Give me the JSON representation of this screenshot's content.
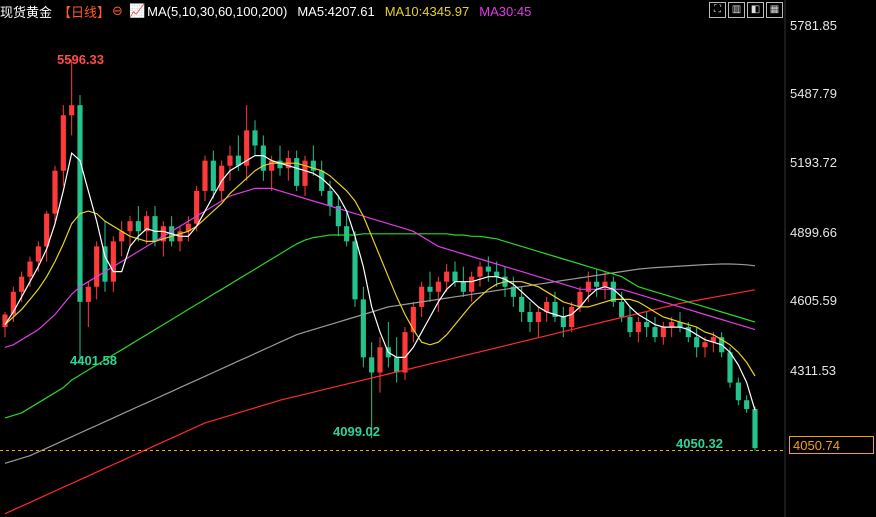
{
  "header": {
    "symbol": "现货黄金",
    "period": "【日线】",
    "ma_label": "MA(5,10,30,60,100,200)",
    "ma5": "MA5:4207.61",
    "ma10": "MA10:4345.97",
    "ma30": "MA30:45"
  },
  "toolbar": [
    "⛶",
    "▥",
    "◧",
    "▦"
  ],
  "colors": {
    "up": "#ff3a3a",
    "down": "#22c38e",
    "ma5": "#ffffff",
    "ma10": "#e8d21c",
    "ma30": "#e23ae6",
    "ma60": "#2bd62b",
    "ma100": "#9a9a9a",
    "ma200": "#ff2b2b",
    "last_line": "#f4a300"
  },
  "chart_data": {
    "type": "candlestick",
    "y_ticks": [
      "5781.85",
      "5487.79",
      "5193.72",
      "4899.66",
      "4605.59",
      "4311.53"
    ],
    "ylim": [
      3787,
      5837
    ],
    "last_price": "4050.74",
    "annotations": {
      "high": "5596.33",
      "low1": "4401.58",
      "low2": "4099.02",
      "low3": "4050.32"
    },
    "candles": [
      [
        4540,
        4600,
        4500,
        4590
      ],
      [
        4590,
        4700,
        4560,
        4680
      ],
      [
        4680,
        4760,
        4640,
        4740
      ],
      [
        4740,
        4820,
        4700,
        4800
      ],
      [
        4800,
        4880,
        4760,
        4860
      ],
      [
        4860,
        5000,
        4800,
        4990
      ],
      [
        4990,
        5180,
        4950,
        5160
      ],
      [
        5160,
        5420,
        5100,
        5380
      ],
      [
        5380,
        5600,
        5300,
        5420
      ],
      [
        5420,
        5460,
        4401,
        4640
      ],
      [
        4640,
        4720,
        4540,
        4700
      ],
      [
        4700,
        4880,
        4650,
        4860
      ],
      [
        4860,
        4960,
        4680,
        4720
      ],
      [
        4720,
        4900,
        4680,
        4880
      ],
      [
        4880,
        4960,
        4820,
        4920
      ],
      [
        4920,
        4980,
        4860,
        4960
      ],
      [
        4960,
        5020,
        4880,
        4920
      ],
      [
        4920,
        5000,
        4870,
        4980
      ],
      [
        4980,
        5020,
        4860,
        4880
      ],
      [
        4880,
        4960,
        4820,
        4940
      ],
      [
        4940,
        4980,
        4860,
        4880
      ],
      [
        4880,
        4940,
        4840,
        4920
      ],
      [
        4920,
        4980,
        4880,
        4950
      ],
      [
        4950,
        5100,
        4920,
        5080
      ],
      [
        5080,
        5220,
        5040,
        5200
      ],
      [
        5200,
        5240,
        5050,
        5080
      ],
      [
        5080,
        5200,
        5040,
        5180
      ],
      [
        5180,
        5260,
        5120,
        5220
      ],
      [
        5220,
        5300,
        5160,
        5180
      ],
      [
        5180,
        5420,
        5120,
        5320
      ],
      [
        5320,
        5360,
        5220,
        5260
      ],
      [
        5260,
        5300,
        5120,
        5160
      ],
      [
        5160,
        5220,
        5080,
        5200
      ],
      [
        5200,
        5260,
        5140,
        5170
      ],
      [
        5170,
        5240,
        5120,
        5210
      ],
      [
        5210,
        5240,
        5080,
        5100
      ],
      [
        5100,
        5220,
        5060,
        5200
      ],
      [
        5200,
        5260,
        5140,
        5160
      ],
      [
        5160,
        5200,
        5060,
        5080
      ],
      [
        5080,
        5120,
        4980,
        5020
      ],
      [
        5020,
        5060,
        4900,
        4940
      ],
      [
        4940,
        5000,
        4860,
        4880
      ],
      [
        4880,
        4920,
        4620,
        4650
      ],
      [
        4650,
        4700,
        4380,
        4420
      ],
      [
        4420,
        4480,
        4099,
        4360
      ],
      [
        4360,
        4500,
        4280,
        4460
      ],
      [
        4460,
        4560,
        4380,
        4420
      ],
      [
        4420,
        4500,
        4320,
        4360
      ],
      [
        4360,
        4540,
        4330,
        4520
      ],
      [
        4520,
        4640,
        4480,
        4620
      ],
      [
        4620,
        4720,
        4580,
        4700
      ],
      [
        4700,
        4760,
        4640,
        4680
      ],
      [
        4680,
        4740,
        4600,
        4720
      ],
      [
        4720,
        4790,
        4680,
        4760
      ],
      [
        4760,
        4800,
        4700,
        4720
      ],
      [
        4720,
        4780,
        4660,
        4680
      ],
      [
        4680,
        4760,
        4640,
        4740
      ],
      [
        4740,
        4800,
        4700,
        4780
      ],
      [
        4780,
        4820,
        4720,
        4760
      ],
      [
        4760,
        4800,
        4700,
        4740
      ],
      [
        4740,
        4780,
        4660,
        4700
      ],
      [
        4700,
        4740,
        4620,
        4660
      ],
      [
        4660,
        4700,
        4560,
        4600
      ],
      [
        4600,
        4640,
        4520,
        4560
      ],
      [
        4560,
        4620,
        4500,
        4600
      ],
      [
        4600,
        4660,
        4560,
        4640
      ],
      [
        4640,
        4680,
        4560,
        4580
      ],
      [
        4580,
        4620,
        4500,
        4540
      ],
      [
        4540,
        4640,
        4520,
        4620
      ],
      [
        4620,
        4700,
        4600,
        4680
      ],
      [
        4680,
        4760,
        4640,
        4720
      ],
      [
        4720,
        4770,
        4660,
        4700
      ],
      [
        4700,
        4760,
        4650,
        4720
      ],
      [
        4720,
        4740,
        4620,
        4640
      ],
      [
        4640,
        4680,
        4560,
        4580
      ],
      [
        4580,
        4620,
        4500,
        4520
      ],
      [
        4520,
        4580,
        4480,
        4560
      ],
      [
        4560,
        4600,
        4500,
        4540
      ],
      [
        4540,
        4580,
        4480,
        4500
      ],
      [
        4500,
        4560,
        4470,
        4540
      ],
      [
        4540,
        4580,
        4500,
        4560
      ],
      [
        4560,
        4600,
        4520,
        4540
      ],
      [
        4540,
        4560,
        4480,
        4500
      ],
      [
        4500,
        4540,
        4420,
        4460
      ],
      [
        4460,
        4500,
        4420,
        4480
      ],
      [
        4480,
        4520,
        4440,
        4500
      ],
      [
        4500,
        4520,
        4420,
        4440
      ],
      [
        4440,
        4460,
        4300,
        4320
      ],
      [
        4320,
        4340,
        4230,
        4250
      ],
      [
        4250,
        4270,
        4200,
        4215
      ],
      [
        4215,
        4225,
        4050,
        4060
      ]
    ],
    "ma5": [
      4550,
      4600,
      4660,
      4720,
      4780,
      4850,
      4950,
      5080,
      5230,
      5200,
      5080,
      4960,
      4820,
      4760,
      4760,
      4860,
      4900,
      4930,
      4920,
      4920,
      4910,
      4900,
      4900,
      4940,
      5000,
      5060,
      5120,
      5160,
      5180,
      5200,
      5220,
      5220,
      5200,
      5190,
      5180,
      5170,
      5160,
      5150,
      5130,
      5100,
      5060,
      5000,
      4900,
      4780,
      4620,
      4520,
      4440,
      4420,
      4420,
      4460,
      4520,
      4580,
      4640,
      4690,
      4720,
      4720,
      4720,
      4730,
      4740,
      4740,
      4730,
      4710,
      4680,
      4650,
      4620,
      4600,
      4590,
      4580,
      4590,
      4620,
      4660,
      4690,
      4700,
      4690,
      4660,
      4620,
      4590,
      4570,
      4550,
      4540,
      4540,
      4540,
      4530,
      4510,
      4490,
      4480,
      4470,
      4440,
      4390,
      4320,
      4210
    ],
    "ma10": [
      4550,
      4580,
      4610,
      4650,
      4690,
      4740,
      4800,
      4870,
      4950,
      4990,
      5000,
      4990,
      4960,
      4940,
      4920,
      4900,
      4890,
      4880,
      4880,
      4890,
      4900,
      4910,
      4920,
      4940,
      4970,
      5000,
      5030,
      5070,
      5100,
      5130,
      5160,
      5180,
      5190,
      5190,
      5190,
      5190,
      5180,
      5170,
      5160,
      5140,
      5110,
      5080,
      5040,
      4980,
      4900,
      4820,
      4740,
      4660,
      4590,
      4530,
      4480,
      4470,
      4480,
      4510,
      4550,
      4590,
      4630,
      4660,
      4690,
      4710,
      4720,
      4720,
      4720,
      4710,
      4700,
      4680,
      4660,
      4640,
      4630,
      4620,
      4620,
      4630,
      4640,
      4650,
      4650,
      4650,
      4640,
      4620,
      4600,
      4580,
      4570,
      4560,
      4550,
      4540,
      4520,
      4510,
      4490,
      4470,
      4440,
      4400,
      4346
    ],
    "ma30": [
      4460,
      4470,
      4490,
      4510,
      4530,
      4560,
      4590,
      4630,
      4670,
      4700,
      4720,
      4740,
      4760,
      4780,
      4800,
      4820,
      4840,
      4860,
      4880,
      4900,
      4920,
      4940,
      4960,
      4980,
      5000,
      5020,
      5040,
      5060,
      5070,
      5080,
      5090,
      5090,
      5090,
      5080,
      5070,
      5060,
      5050,
      5040,
      5030,
      5020,
      5010,
      5000,
      4990,
      4980,
      4970,
      4960,
      4950,
      4940,
      4930,
      4920,
      4900,
      4880,
      4860,
      4850,
      4840,
      4830,
      4820,
      4810,
      4800,
      4790,
      4780,
      4770,
      4760,
      4750,
      4740,
      4730,
      4720,
      4710,
      4700,
      4690,
      4690,
      4690,
      4690,
      4690,
      4690,
      4680,
      4670,
      4660,
      4650,
      4640,
      4630,
      4620,
      4610,
      4600,
      4590,
      4580,
      4570,
      4560,
      4550,
      4540,
      4530
    ],
    "ma60": [
      4180,
      4190,
      4200,
      4220,
      4240,
      4260,
      4280,
      4300,
      4330,
      4350,
      4370,
      4390,
      4410,
      4430,
      4450,
      4470,
      4490,
      4510,
      4530,
      4550,
      4570,
      4590,
      4610,
      4630,
      4650,
      4670,
      4690,
      4710,
      4730,
      4750,
      4770,
      4790,
      4810,
      4830,
      4850,
      4870,
      4885,
      4895,
      4900,
      4905,
      4905,
      4905,
      4905,
      4910,
      4910,
      4910,
      4910,
      4910,
      4910,
      4910,
      4910,
      4910,
      4910,
      4910,
      4905,
      4905,
      4900,
      4900,
      4895,
      4890,
      4880,
      4870,
      4860,
      4850,
      4840,
      4830,
      4820,
      4810,
      4800,
      4790,
      4780,
      4770,
      4760,
      4750,
      4740,
      4720,
      4700,
      4690,
      4680,
      4670,
      4660,
      4650,
      4640,
      4630,
      4620,
      4610,
      4600,
      4590,
      4580,
      4570,
      4560
    ],
    "ma100": [
      4000,
      4010,
      4020,
      4030,
      4045,
      4060,
      4075,
      4090,
      4105,
      4120,
      4135,
      4150,
      4165,
      4180,
      4195,
      4210,
      4225,
      4240,
      4255,
      4270,
      4285,
      4300,
      4315,
      4330,
      4345,
      4360,
      4375,
      4390,
      4405,
      4420,
      4435,
      4450,
      4465,
      4480,
      4495,
      4510,
      4520,
      4530,
      4540,
      4550,
      4560,
      4570,
      4580,
      4590,
      4600,
      4610,
      4620,
      4625,
      4630,
      4635,
      4640,
      4645,
      4650,
      4655,
      4660,
      4665,
      4670,
      4675,
      4680,
      4685,
      4690,
      4695,
      4700,
      4705,
      4710,
      4715,
      4720,
      4725,
      4730,
      4735,
      4740,
      4745,
      4750,
      4755,
      4760,
      4765,
      4770,
      4773,
      4776,
      4778,
      4780,
      4782,
      4784,
      4786,
      4788,
      4789,
      4790,
      4790,
      4789,
      4787,
      4783
    ],
    "ma200": [
      3800,
      3815,
      3830,
      3845,
      3860,
      3875,
      3890,
      3905,
      3920,
      3935,
      3950,
      3965,
      3980,
      3995,
      4010,
      4025,
      4040,
      4055,
      4070,
      4085,
      4100,
      4115,
      4130,
      4145,
      4160,
      4170,
      4180,
      4190,
      4200,
      4210,
      4220,
      4230,
      4240,
      4250,
      4258,
      4266,
      4274,
      4282,
      4290,
      4298,
      4306,
      4314,
      4322,
      4330,
      4338,
      4346,
      4354,
      4362,
      4370,
      4378,
      4386,
      4394,
      4402,
      4410,
      4418,
      4426,
      4434,
      4442,
      4450,
      4458,
      4466,
      4474,
      4482,
      4490,
      4498,
      4506,
      4514,
      4522,
      4530,
      4538,
      4546,
      4554,
      4562,
      4570,
      4578,
      4586,
      4594,
      4602,
      4610,
      4618,
      4626,
      4634,
      4640,
      4646,
      4652,
      4658,
      4664,
      4670,
      4676,
      4682,
      4688
    ]
  }
}
